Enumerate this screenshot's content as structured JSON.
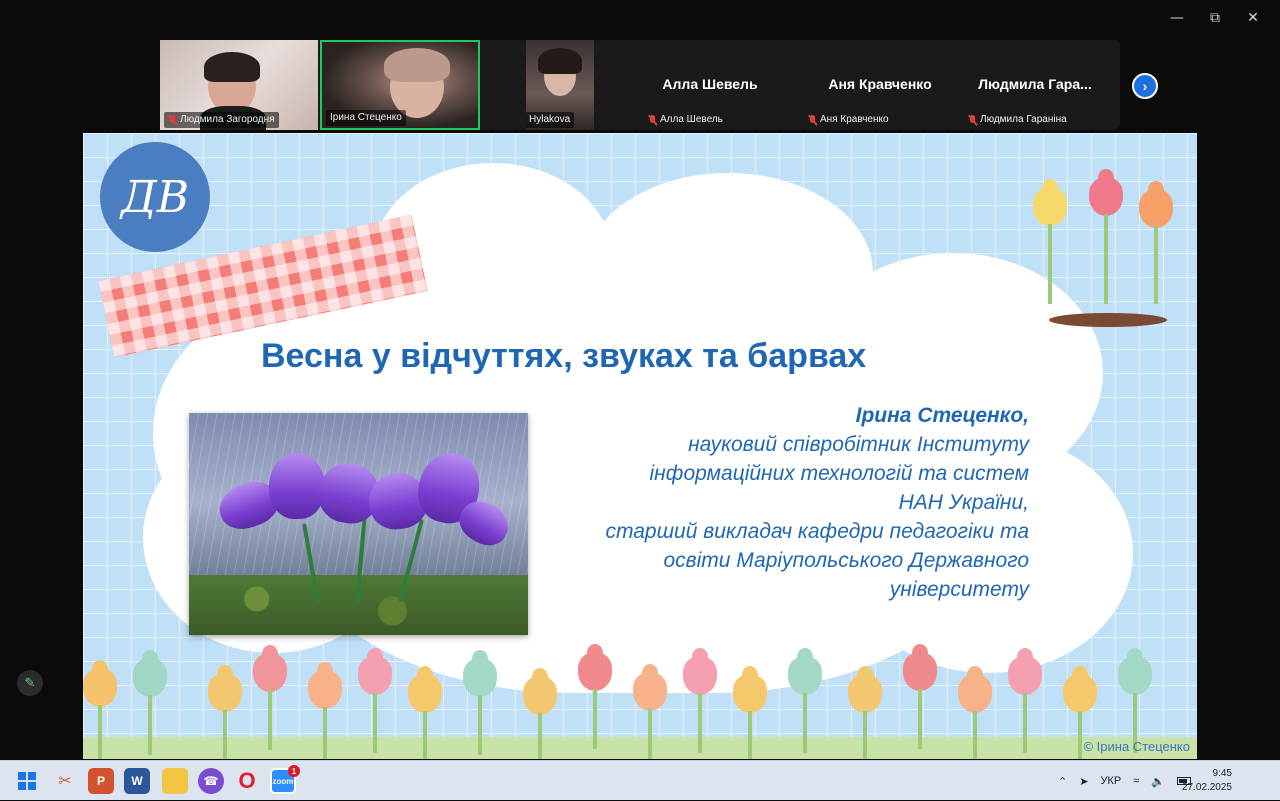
{
  "window": {
    "minimize_icon": "minimize-icon",
    "maximize_icon": "restore-icon",
    "close_icon": "close-icon"
  },
  "participants": {
    "video_tiles": [
      {
        "name": "Людмила Загородня"
      },
      {
        "name": "Ірина Стеценко"
      },
      {
        "name": "Luda Hylakova"
      }
    ],
    "name_tiles": [
      {
        "big_name": "Алла Шевель",
        "tag": "Алла Шевель"
      },
      {
        "big_name": "Аня Кравченко",
        "tag": "Аня Кравченко"
      },
      {
        "big_name": "Людмила  Гара...",
        "tag": "Людмила Гаранiна"
      }
    ],
    "next_label": "›"
  },
  "slide": {
    "logo_text": "ДВ",
    "title": "Весна у відчуттях, звуках та барвах",
    "author_name": "Ірина Стеценко,",
    "author_lines": [
      "науковий співробітник Інституту",
      "інформаційних технологій та систем",
      "НАН України,",
      "старший викладач кафедри педагогіки та",
      "освіти  Маріупольського Державного",
      "університету"
    ],
    "copyright": "© Ірина Стеценко"
  },
  "taskbar": {
    "apps": [
      {
        "name": "start-icon",
        "label": ""
      },
      {
        "name": "snipping-icon",
        "label": ""
      },
      {
        "name": "powerpoint-icon",
        "label": "P"
      },
      {
        "name": "word-icon",
        "label": "W"
      },
      {
        "name": "file-explorer-icon",
        "label": ""
      },
      {
        "name": "viber-icon",
        "label": ""
      },
      {
        "name": "opera-icon",
        "label": "O"
      },
      {
        "name": "zoom-icon",
        "label": "zoom",
        "badge": "1"
      }
    ],
    "language": "УКР",
    "time": "9:45",
    "date": "27.02.2025"
  },
  "colors": {
    "accent_blue": "#1f66b3",
    "active_speaker": "#22c55e",
    "mic_off": "#e03c3c"
  }
}
